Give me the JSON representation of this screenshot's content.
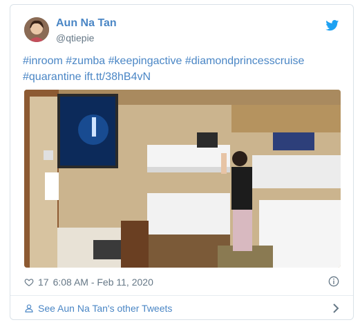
{
  "tweet": {
    "author_name": "Aun Na Tan",
    "author_handle": "@qtiepie",
    "text_tags": [
      "#inroom",
      "#zumba",
      "#keepingactive",
      "#diamondprincesscruise"
    ],
    "text_line2": [
      "#quarantine",
      "ift.tt/38hB4vN"
    ],
    "likes": "17",
    "timestamp": "6:08 AM - Feb 11, 2020",
    "footer_link": "See Aun Na Tan's other Tweets"
  },
  "colors": {
    "link": "#4a86c5",
    "muted": "#657786",
    "twitter_blue": "#1da1f2"
  },
  "icons": {
    "logo": "twitter-bird-icon",
    "like": "heart-icon",
    "info": "info-icon",
    "profile": "person-icon",
    "more": "chevron-right-icon"
  }
}
